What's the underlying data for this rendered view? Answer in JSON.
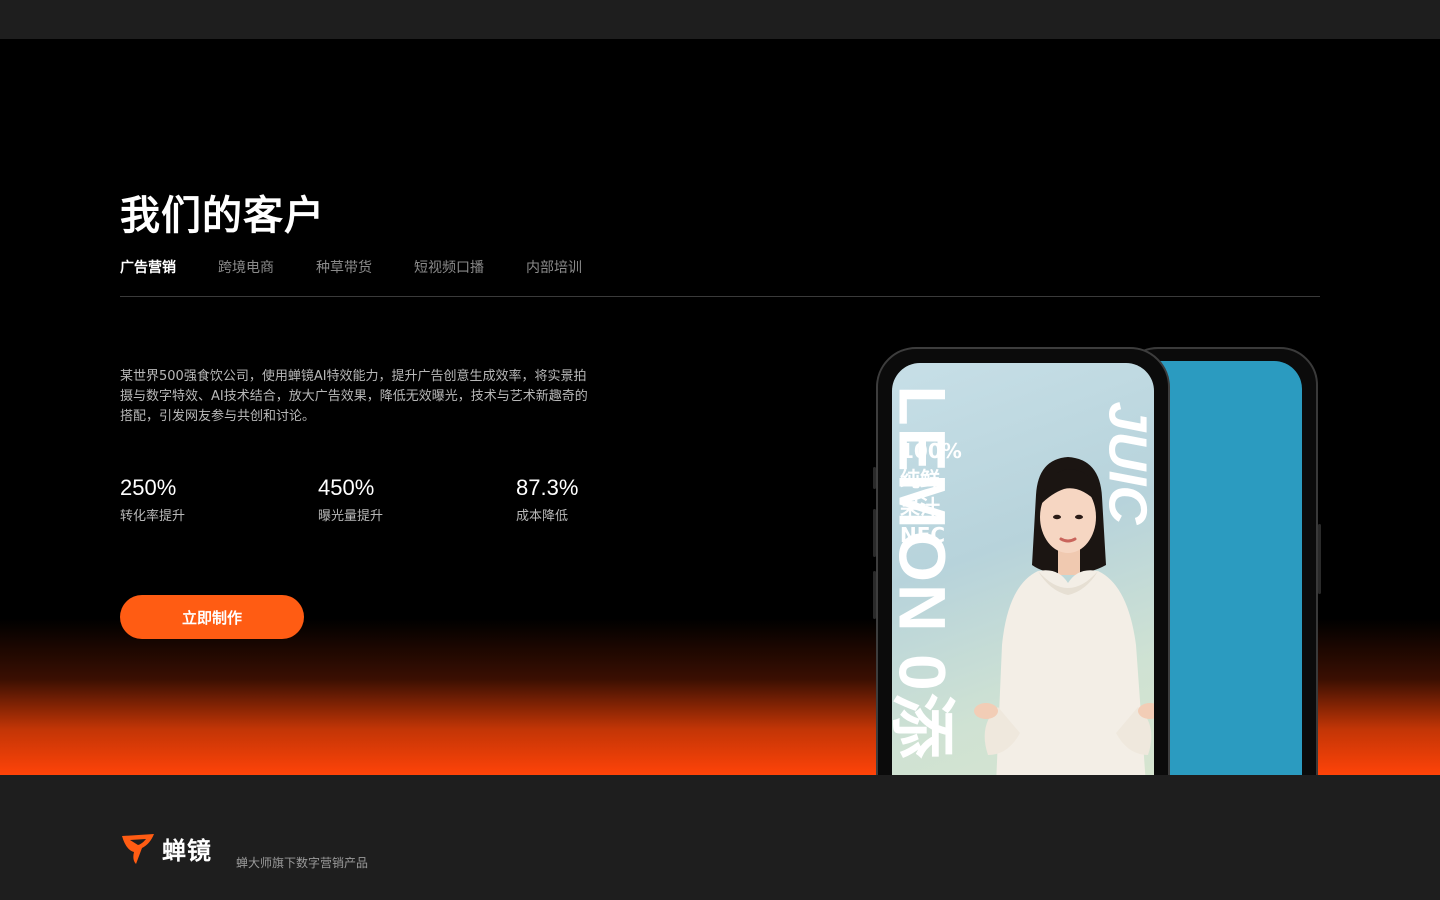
{
  "section": {
    "title": "我们的客户",
    "tabs": [
      {
        "label": "广告营销",
        "active": true
      },
      {
        "label": "跨境电商",
        "active": false
      },
      {
        "label": "种草带货",
        "active": false
      },
      {
        "label": "短视频口播",
        "active": false
      },
      {
        "label": "内部培训",
        "active": false
      }
    ],
    "description": "某世界500强食饮公司，使用蝉镜AI特效能力，提升广告创意生成效率，将实景拍摄与数字特效、AI技术结合，放大广告效果，降低无效曝光，技术与艺术新趣奇的搭配，引发网友参与共创和讨论。",
    "stats": [
      {
        "value": "250%",
        "label": "转化率提升"
      },
      {
        "value": "450%",
        "label": "曝光量提升"
      },
      {
        "value": "87.3%",
        "label": "成本降低"
      }
    ],
    "cta_label": "立即制作"
  },
  "phone_media": {
    "left_text": "LEMON 0添",
    "right_text": "JUIC",
    "promo_lines": [
      "100%",
      "纯鲜",
      "果汁",
      "NFC"
    ]
  },
  "footer": {
    "logo_name": "蝉镜",
    "tagline": "蝉大师旗下数字营销产品"
  },
  "colors": {
    "accent": "#ff5c13",
    "gradient_bottom": "#ff4308",
    "phone_back_screen": "#2b9bc0"
  }
}
